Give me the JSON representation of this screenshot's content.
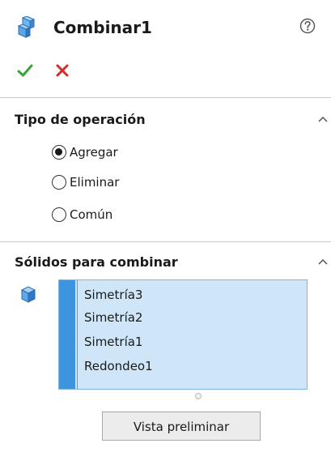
{
  "header": {
    "title": "Combinar1",
    "feature_icon": "combine-feature-icon",
    "help_icon": "help-icon",
    "ok_icon": "checkmark-icon",
    "cancel_icon": "close-icon"
  },
  "operation_type": {
    "title": "Tipo de operación",
    "options": [
      {
        "label": "Agregar",
        "selected": true
      },
      {
        "label": "Eliminar",
        "selected": false
      },
      {
        "label": "Común",
        "selected": false
      }
    ]
  },
  "bodies": {
    "title": "Sólidos para combinar",
    "icon": "solid-body-icon",
    "items": [
      "Simetría3",
      "Simetría2",
      "Simetría1",
      "Redondeo1"
    ]
  },
  "preview_button": {
    "label": "Vista preliminar"
  },
  "colors": {
    "ok": "#3aa335",
    "cancel": "#d52b2b",
    "list_background": "#cfe6f8",
    "list_accent": "#3d95e0"
  }
}
